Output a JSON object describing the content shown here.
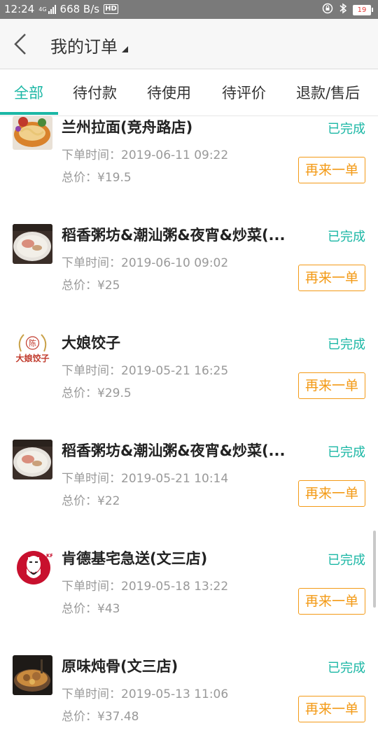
{
  "statusbar": {
    "time": "12:24",
    "network": "4G",
    "speed": "668 B/s",
    "hd": "HD",
    "battery": "19",
    "colors": {
      "bar": "#7a7a7a",
      "battery_text": "#e53935"
    }
  },
  "header": {
    "title": "我的订单"
  },
  "tabs": [
    {
      "label": "全部",
      "active": true
    },
    {
      "label": "待付款",
      "active": false
    },
    {
      "label": "待使用",
      "active": false
    },
    {
      "label": "待评价",
      "active": false
    },
    {
      "label": "退款/售后",
      "active": false
    }
  ],
  "orders": [
    {
      "shop": "兰州拉面(竞舟路店)",
      "status": "已完成",
      "time": "下单时间：2019-06-11 09:22",
      "price": "总价：¥19.5",
      "button": "再来一单",
      "thumb_icon": "noodle-photo"
    },
    {
      "shop": "稻香粥坊&潮汕粥&夜宵&炒菜(...",
      "status": "已完成",
      "time": "下单时间：2019-06-10 09:02",
      "price": "总价：¥25",
      "button": "再来一单",
      "thumb_icon": "porridge-photo"
    },
    {
      "shop": "大娘饺子",
      "status": "已完成",
      "time": "下单时间：2019-05-21 16:25",
      "price": "总价：¥29.5",
      "button": "再来一单",
      "thumb_icon": "dumpling-logo",
      "logo_text": "大娘饺子",
      "logo_badge": "陈"
    },
    {
      "shop": "稻香粥坊&潮汕粥&夜宵&炒菜(...",
      "status": "已完成",
      "time": "下单时间：2019-05-21 10:14",
      "price": "总价：¥22",
      "button": "再来一单",
      "thumb_icon": "porridge-photo"
    },
    {
      "shop": "肯德基宅急送(文三店)",
      "status": "已完成",
      "time": "下单时间：2019-05-18 13:22",
      "price": "总价：¥43",
      "button": "再来一单",
      "thumb_icon": "kfc-logo",
      "logo_text": "KFC"
    },
    {
      "shop": "原味炖骨(文三店)",
      "status": "已完成",
      "time": "下单时间：2019-05-13 11:06",
      "price": "总价：¥37.48",
      "button": "再来一单",
      "thumb_icon": "stew-photo"
    }
  ],
  "colors": {
    "accent": "#1bb7a5",
    "reorder": "#f39a16",
    "muted": "#999999"
  }
}
